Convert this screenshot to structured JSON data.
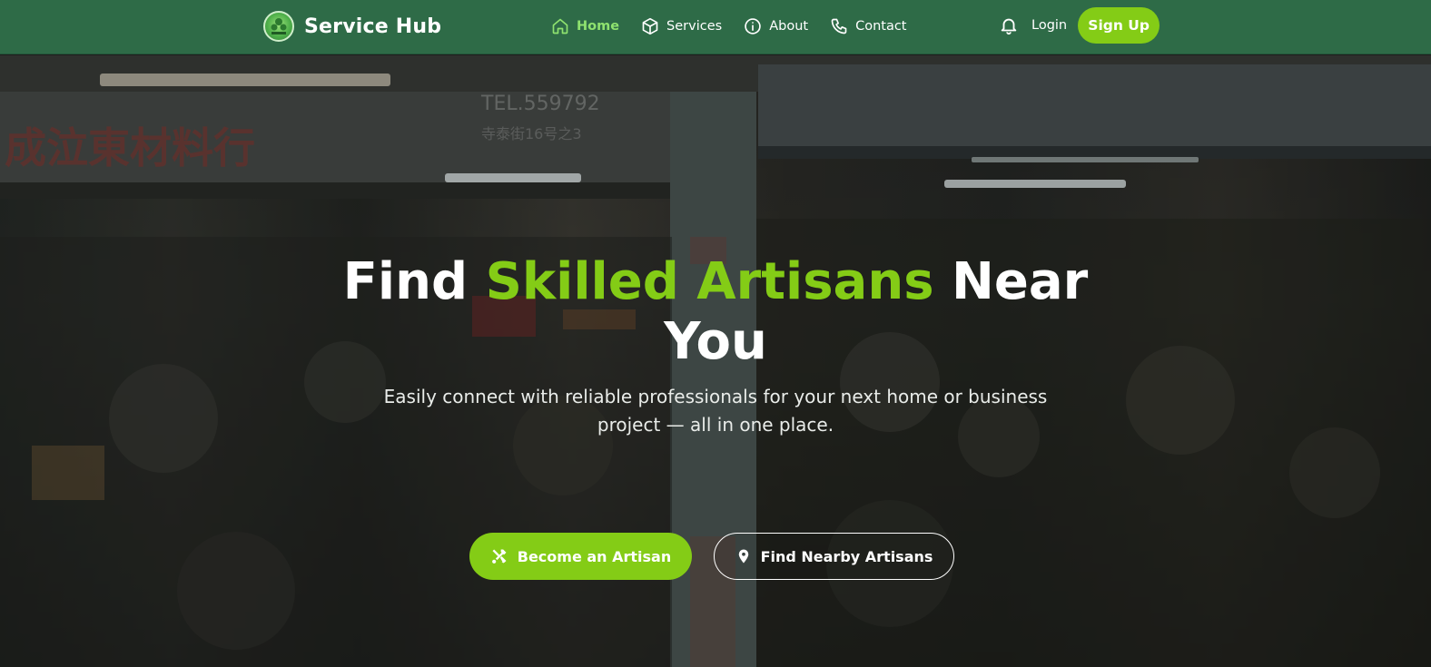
{
  "brand": {
    "name": "Service Hub",
    "logo_icon": "logo-icon"
  },
  "nav": {
    "links": [
      {
        "label": "Home",
        "icon": "home-icon",
        "active": true
      },
      {
        "label": "Services",
        "icon": "box-icon",
        "active": false
      },
      {
        "label": "About",
        "icon": "info-icon",
        "active": false
      },
      {
        "label": "Contact",
        "icon": "phone-icon",
        "active": false
      }
    ],
    "notification_icon": "bell-icon",
    "login_label": "Login",
    "signup_label": "Sign Up"
  },
  "hero": {
    "title_part1": "Find",
    "title_accent": "Skilled Artisans",
    "title_part2": "Near",
    "title_line2": "You",
    "subtitle": "Easily connect with reliable professionals for your next home or business project — all in one place.",
    "primary_button": {
      "label": "Become an Artisan",
      "icon": "tools-icon"
    },
    "secondary_button": {
      "label": "Find Nearby Artisans",
      "icon": "map-pin-icon"
    },
    "background": {
      "sign_text": "成泣東材料行",
      "tel_text": "TEL.559792",
      "address_text": "寺泰街16号之3"
    }
  },
  "colors": {
    "navbar": "#2e6b47",
    "accent": "#84cc16",
    "active_link": "#8fe26f",
    "text": "#ffffff"
  }
}
